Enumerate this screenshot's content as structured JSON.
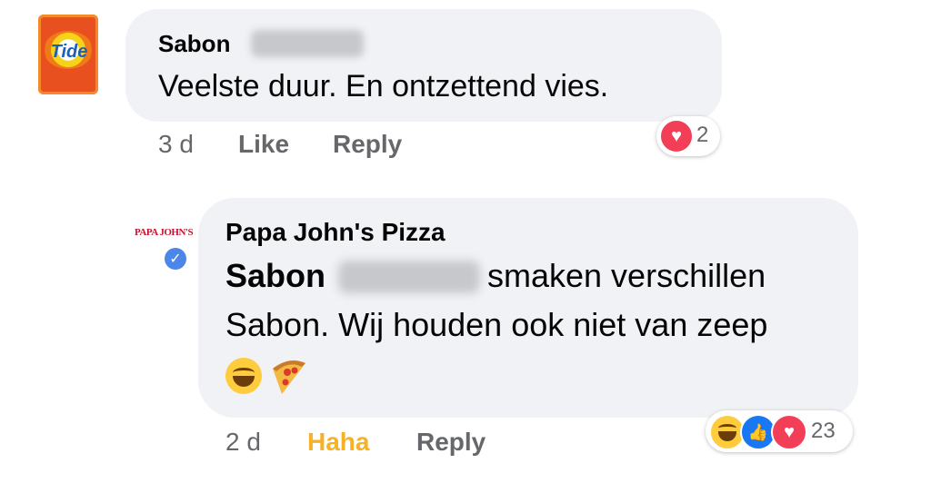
{
  "comment1": {
    "avatar_icon": "tide-detergent-avatar",
    "avatar_logo_text": "Tide",
    "author_first": "Sabon",
    "text": "Veelste duur. En ontzettend vies.",
    "time": "3 d",
    "like_label": "Like",
    "reply_label": "Reply",
    "reactions": {
      "icons": [
        "love-icon"
      ],
      "count": "2"
    }
  },
  "comment2": {
    "avatar_icon": "papa-johns-avatar",
    "avatar_logo_text": "PAPA JOHN'S",
    "verified_icon": "verified-badge-icon",
    "author": "Papa John's Pizza",
    "mention_first": "Sabon",
    "text_line1_rest": "smaken verschillen",
    "text_line2": "Sabon. Wij houden ook niet van zeep",
    "emojis": [
      "grinning-face-emoji",
      "pizza-emoji"
    ],
    "time": "2 d",
    "reaction_label": "Haha",
    "reply_label": "Reply",
    "reactions": {
      "icons": [
        "haha-icon",
        "like-icon",
        "love-icon"
      ],
      "count": "23"
    }
  },
  "colors": {
    "bubble": "#f0f2f5",
    "meta_text": "#65676b",
    "haha_active": "#f7b125",
    "love": "#f33e58",
    "like": "#1877f2"
  }
}
